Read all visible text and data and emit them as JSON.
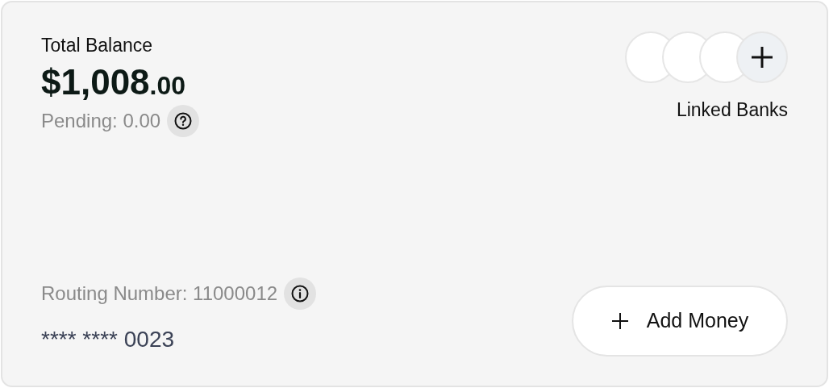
{
  "balance": {
    "label": "Total Balance",
    "amount": "**$1,008**.00",
    "pending": "Pending: 0.00"
  },
  "linked_banks": {
    "label": "Linked Banks",
    "slots": [
      {
        "kind": "empty"
      },
      {
        "kind": "empty"
      },
      {
        "kind": "empty"
      }
    ]
  },
  "account": {
    "routing": "Routing Number: 11000012",
    "number": "**** **** 0023"
  },
  "add_money_button": {
    "label": "Add Money"
  }
}
